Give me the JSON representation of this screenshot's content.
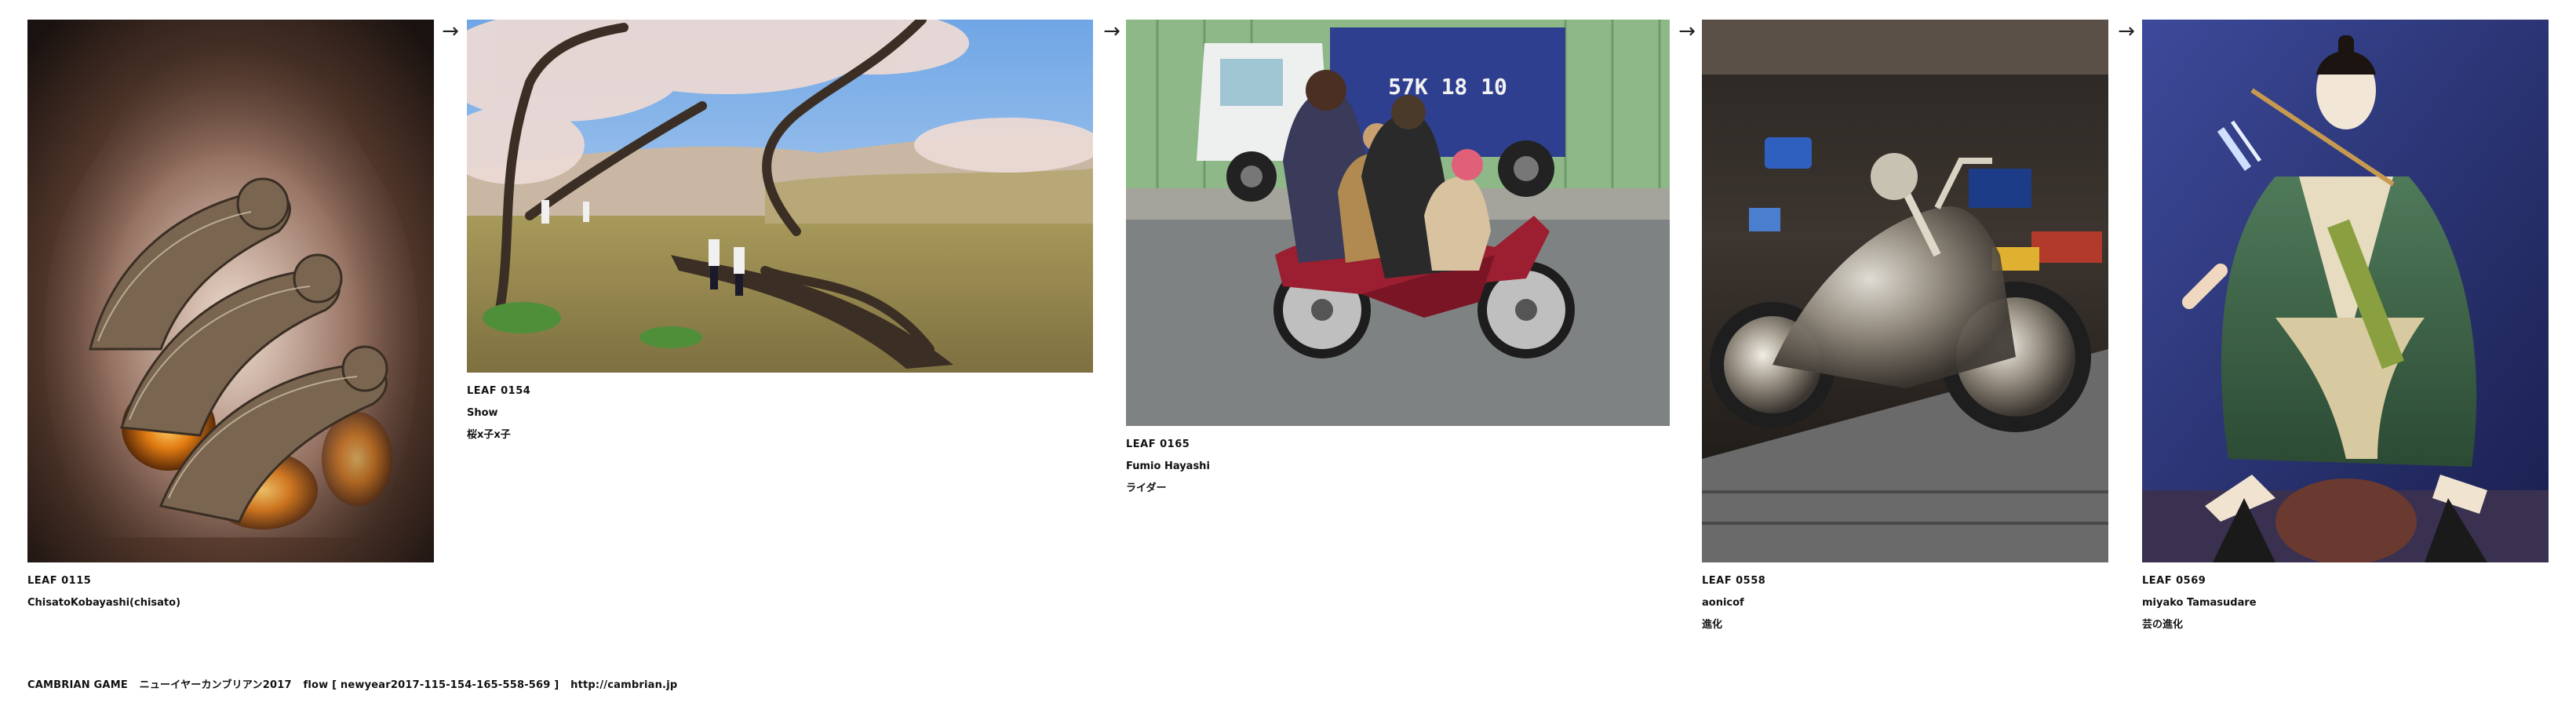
{
  "leaves": [
    {
      "id": "LEAF 0115",
      "author": "ChisatoKobayashi(chisato)",
      "title": ""
    },
    {
      "id": "LEAF 0154",
      "author": "Show",
      "title": "桜x子x子"
    },
    {
      "id": "LEAF 0165",
      "author": "Fumio Hayashi",
      "title": "ライダー"
    },
    {
      "id": "LEAF 0558",
      "author": "aonicof",
      "title": "進化"
    },
    {
      "id": "LEAF 0569",
      "author": "miyako Tamasudare",
      "title": "芸の進化"
    }
  ],
  "arrow_glyph": "→",
  "footer": {
    "brand": "CAMBRIAN GAME",
    "event": "ニューイヤーカンブリアン2017",
    "flow": "flow [ newyear2017-115-154-165-558-569 ]",
    "url": "http://cambrian.jp"
  },
  "colors": {
    "background": "#ffffff",
    "text": "#111111"
  }
}
